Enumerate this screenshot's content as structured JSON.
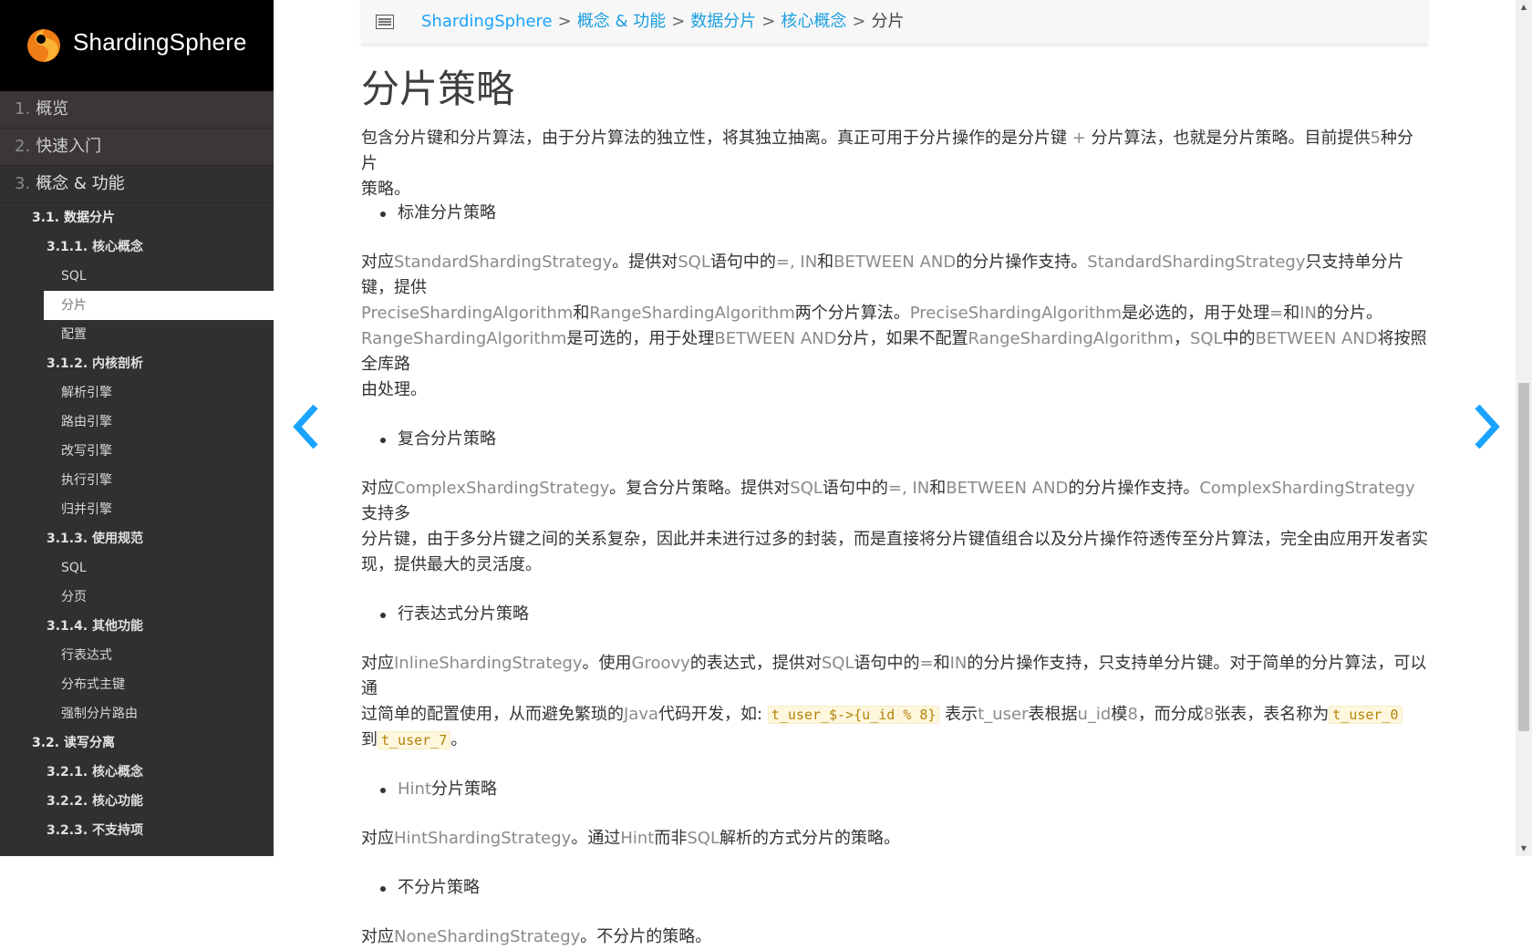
{
  "app": {
    "logo_text": "ShardingSphere"
  },
  "sidebar": {
    "top_items": [
      {
        "num": "1.",
        "label": "概览"
      },
      {
        "num": "2.",
        "label": "快速入门"
      },
      {
        "num": "3.",
        "label": "概念 & 功能"
      }
    ],
    "tree": [
      {
        "level": 1,
        "label": "3.1. 数据分片"
      },
      {
        "level": 2,
        "label": "3.1.1. 核心概念"
      },
      {
        "level": 3,
        "label": "SQL"
      },
      {
        "level": 3,
        "label": "分片",
        "selected": true
      },
      {
        "level": 3,
        "label": "配置"
      },
      {
        "level": 2,
        "label": "3.1.2. 内核剖析"
      },
      {
        "level": 3,
        "label": "解析引擎"
      },
      {
        "level": 3,
        "label": "路由引擎"
      },
      {
        "level": 3,
        "label": "改写引擎"
      },
      {
        "level": 3,
        "label": "执行引擎"
      },
      {
        "level": 3,
        "label": "归并引擎"
      },
      {
        "level": 2,
        "label": "3.1.3. 使用规范"
      },
      {
        "level": 3,
        "label": "SQL"
      },
      {
        "level": 3,
        "label": "分页"
      },
      {
        "level": 2,
        "label": "3.1.4. 其他功能"
      },
      {
        "level": 3,
        "label": "行表达式"
      },
      {
        "level": 3,
        "label": "分布式主键"
      },
      {
        "level": 3,
        "label": "强制分片路由"
      },
      {
        "level": 1,
        "label": "3.2. 读写分离"
      },
      {
        "level": 2,
        "label": "3.2.1. 核心概念"
      },
      {
        "level": 2,
        "label": "3.2.2. 核心功能"
      },
      {
        "level": 2,
        "label": "3.2.3. 不支持项"
      }
    ]
  },
  "breadcrumb": {
    "items": [
      "ShardingSphere",
      "概念 & 功能",
      "数据分片",
      "核心概念"
    ],
    "separator": ">",
    "current": "分片"
  },
  "page": {
    "title": "分片策略",
    "intro": {
      "a": "包含分片键和分片算法，由于分片算法的独立性，将其独立抽离。真正可用于分片操作的是分片键 ",
      "plus": "+",
      "b": " 分片算法，也就是分片策略。目前提供",
      "five": "5",
      "c": "种分片",
      "d": "策略。"
    },
    "std": {
      "bullet": "标准分片策略",
      "t1": "对应",
      "t2": "StandardShardingStrategy",
      "t3": "。提供对",
      "t4": "SQL",
      "t5": "语句中的",
      "t6": "=, IN",
      "t7": "和",
      "t8": "BETWEEN AND",
      "t9": "的分片操作支持。",
      "t10": "StandardShardingStrategy",
      "t11": "只支持单分片键，提供",
      "t12": "PreciseShardingAlgorithm",
      "t13": "和",
      "t14": "RangeShardingAlgorithm",
      "t15": "两个分片算法。",
      "t16": "PreciseShardingAlgorithm",
      "t17": "是必选的，用于处理",
      "t18": "=",
      "t19": "和",
      "t20": "IN",
      "t21": "的分片。",
      "t22": "RangeShardingAlgorithm",
      "t23": "是可选的，用于处理",
      "t24": "BETWEEN AND",
      "t25": "分片，如果不配置",
      "t26": "RangeShardingAlgorithm",
      "t27": "，",
      "t28": "SQL",
      "t29": "中的",
      "t30": "BETWEEN AND",
      "t31": "将按照全库路",
      "t32": "由处理。"
    },
    "complex": {
      "bullet": "复合分片策略",
      "t1": "对应",
      "t2": "ComplexShardingStrategy",
      "t3": "。复合分片策略。提供对",
      "t4": "SQL",
      "t5": "语句中的",
      "t6": "=, IN",
      "t7": "和",
      "t8": "BETWEEN AND",
      "t9": "的分片操作支持。",
      "t10": "ComplexShardingStrategy",
      "t11": "支持多",
      "t12": "分片键，由于多分片键之间的关系复杂，因此并未进行过多的封装，而是直接将分片键值组合以及分片操作符透传至分片算法，完全由应用开发者实",
      "t13": "现，提供最大的灵活度。"
    },
    "inline": {
      "bullet": "行表达式分片策略",
      "t1": "对应",
      "t2": "InlineShardingStrategy",
      "t3": "。使用",
      "t4": "Groovy",
      "t5": "的表达式，提供对",
      "t6": "SQL",
      "t7": "语句中的",
      "t8": "=",
      "t9": "和",
      "t10": "IN",
      "t11": "的分片操作支持，只支持单分片键。对于简单的分片算法，可以通",
      "t12": "过简单的配置使用，从而避免繁琐的",
      "t13": "Java",
      "t14": "代码开发，如: ",
      "code1": "t_user_$->{u_id % 8}",
      "t15": " 表示",
      "t16": "t_user",
      "t17": "表根据",
      "t18": "u_id",
      "t19": "模",
      "t20": "8",
      "t21": "，而分成",
      "t22": "8",
      "t23": "张表，表名称为",
      "code2": "t_user_0",
      "t24": "到",
      "code3": "t_user_7",
      "t25": "。"
    },
    "hint": {
      "bullet_term": "Hint",
      "bullet": "分片策略",
      "t1": "对应",
      "t2": "HintShardingStrategy",
      "t3": "。通过",
      "t4": "Hint",
      "t5": "而非",
      "t6": "SQL",
      "t7": "解析的方式分片的策略。"
    },
    "none": {
      "bullet": "不分片策略",
      "t1": "对应",
      "t2": "NoneShardingStrategy",
      "t3": "。不分片的策略。"
    }
  },
  "colors": {
    "link": "#1aa3ff",
    "sidebar_bg": "#322f31",
    "term": "#8a8a8a",
    "arrow": "#1aa3ff"
  },
  "icons": {
    "menu": "menu-icon",
    "prev": "chevron-left-icon",
    "next": "chevron-right-icon"
  }
}
